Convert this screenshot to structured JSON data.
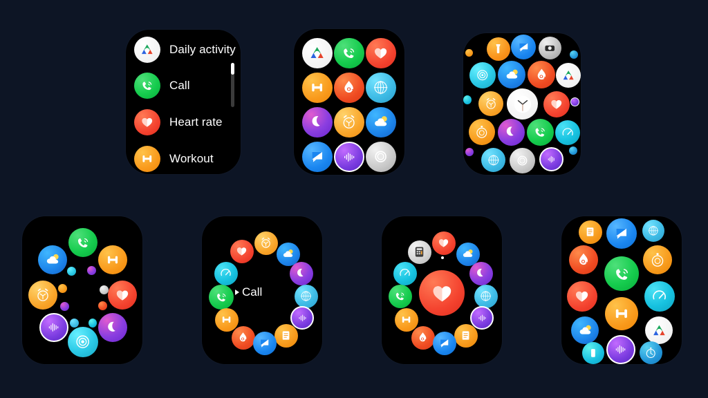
{
  "page": {
    "title": "Smartwatch app launcher layout styles",
    "background_color": "#0d1525",
    "watch_screen_color": "#000000"
  },
  "apps": {
    "activity": {
      "label": "Daily activity",
      "icon": "activity-rings-icon",
      "color": "#ffffff"
    },
    "call": {
      "label": "Call",
      "icon": "phone-call-icon",
      "color": "#16cc4e"
    },
    "heart": {
      "label": "Heart rate",
      "icon": "heart-icon",
      "color": "#f4432f"
    },
    "workout": {
      "label": "Workout",
      "icon": "dumbbell-icon",
      "color": "#f99a1c"
    },
    "spo2": {
      "label": "Blood oxygen",
      "icon": "spo2-droplet-icon",
      "color": "#ef4b22"
    },
    "compass": {
      "label": "Compass",
      "icon": "compass-icon",
      "color": "#3fbce6"
    },
    "sleep": {
      "label": "Sleep",
      "icon": "moon-icon",
      "color": "#8a3ee0"
    },
    "alarm": {
      "label": "Alarm",
      "icon": "alarm-clock-icon",
      "color": "#f9a52a"
    },
    "weather": {
      "label": "Weather",
      "icon": "cloud-sun-icon",
      "color": "#1d84ea"
    },
    "message": {
      "label": "Messages",
      "icon": "message-bubble-icon",
      "color": "#1a86f0"
    },
    "recorder": {
      "label": "Voice recorder",
      "icon": "waveform-icon",
      "color": "#7b3ce0"
    },
    "settings": {
      "label": "Settings",
      "icon": "gear-icon",
      "color": "#c9c9c9"
    },
    "flashlight": {
      "label": "Flashlight",
      "icon": "flashlight-icon",
      "color": "#f9931c"
    },
    "camera": {
      "label": "Camera",
      "icon": "camera-icon",
      "color": "#bdbdbd"
    },
    "stress": {
      "label": "Stress",
      "icon": "stress-rings-icon",
      "color": "#2bc9e6"
    },
    "clock": {
      "label": "Clock",
      "icon": "analog-clock-icon",
      "color": "#ffffff"
    },
    "timer": {
      "label": "Timer",
      "icon": "timer-icon",
      "color": "#f79a1c"
    },
    "speed": {
      "label": "Speed",
      "icon": "speedometer-icon",
      "color": "#17c2e0"
    },
    "notes": {
      "label": "Notes",
      "icon": "notes-icon",
      "color": "#f79a1c"
    },
    "calculator": {
      "label": "Calculator",
      "icon": "calculator-icon",
      "color": "#d2d2d2"
    },
    "stopwatch": {
      "label": "Stopwatch",
      "icon": "stopwatch-icon",
      "color": "#2296d8"
    },
    "phonefind": {
      "label": "Find phone",
      "icon": "phone-device-icon",
      "color": "#17bfe0"
    },
    "world": {
      "label": "World clock",
      "icon": "globe-icon",
      "color": "#2fa6e0"
    }
  },
  "watches": [
    {
      "name": "list-layout-watch",
      "layout": "list",
      "items": [
        {
          "app": "activity",
          "label": "Daily activity"
        },
        {
          "app": "call",
          "label": "Call"
        },
        {
          "app": "heart",
          "label": "Heart rate"
        },
        {
          "app": "workout",
          "label": "Workout"
        }
      ],
      "scrollbar": {
        "visible": true,
        "thumb_position": "top"
      }
    },
    {
      "name": "grid-layout-watch",
      "layout": "grid-3x4",
      "items": [
        "activity",
        "call",
        "heart",
        "workout",
        "spo2",
        "compass",
        "sleep",
        "alarm",
        "weather",
        "message",
        "recorder",
        "settings"
      ]
    },
    {
      "name": "honeycomb-layout-watch",
      "layout": "honeycomb",
      "items": [
        "flashlight",
        "message",
        "camera",
        "stress",
        "weather",
        "spo2",
        "activity",
        "alarm",
        "clock",
        "heart",
        "timer",
        "sleep",
        "call",
        "speed",
        "compass",
        "settings",
        "recorder"
      ]
    },
    {
      "name": "circular-cluster-watch",
      "layout": "circular-cluster",
      "items": [
        "call",
        "workout",
        "weather",
        "heart",
        "alarm",
        "sleep",
        "recorder",
        "stress"
      ]
    },
    {
      "name": "rotary-carousel-watch",
      "layout": "rotary-carousel",
      "selected_label": "Call",
      "items": [
        "alarm",
        "weather",
        "sleep",
        "compass",
        "recorder",
        "notes",
        "message",
        "spo2",
        "workout",
        "call",
        "speed",
        "heart"
      ]
    },
    {
      "name": "rotary-focus-watch",
      "layout": "rotary-focus",
      "focused_app": "heart",
      "items": [
        "heart",
        "weather",
        "sleep",
        "compass",
        "recorder",
        "notes",
        "message",
        "spo2",
        "workout",
        "call",
        "speed",
        "calculator"
      ]
    },
    {
      "name": "vertical-column-watch",
      "layout": "vertical-column",
      "items": [
        "notes",
        "message",
        "compass",
        "spo2",
        "timer",
        "call",
        "heart",
        "speed",
        "workout",
        "weather",
        "activity",
        "phonefind",
        "recorder",
        "stopwatch"
      ]
    }
  ]
}
